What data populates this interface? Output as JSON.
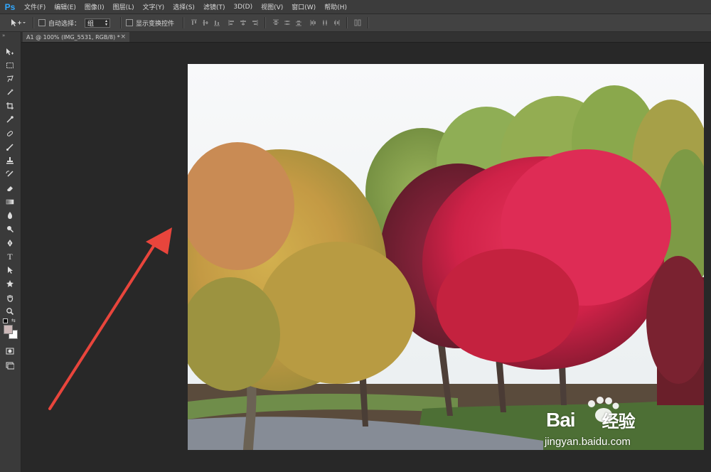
{
  "app": {
    "logo": "Ps"
  },
  "menu": [
    "文件(F)",
    "编辑(E)",
    "图像(I)",
    "图层(L)",
    "文字(Y)",
    "选择(S)",
    "滤镜(T)",
    "3D(D)",
    "视图(V)",
    "窗口(W)",
    "帮助(H)"
  ],
  "options": {
    "auto_select_label": "自动选择：",
    "auto_select_value": "组",
    "show_transform_label": "显示变换控件"
  },
  "document_tab": {
    "title": "A1 @ 100% (IMG_5531, RGB/8) *",
    "close": "×"
  },
  "tools": [
    "move-icon",
    "marquee-icon",
    "lasso-icon",
    "quick-select-icon",
    "crop-icon",
    "eyedropper-icon",
    "healing-brush-icon",
    "brush-icon",
    "stamp-icon",
    "history-brush-icon",
    "eraser-icon",
    "gradient-icon",
    "blur-icon",
    "dodge-icon",
    "pen-icon",
    "type-icon",
    "path-select-icon",
    "shape-icon",
    "hand-icon",
    "zoom-icon",
    "color-swatch-icon",
    "quick-mask-icon",
    "screen-mode-icon"
  ],
  "tool_glyphs": {
    "type": "T"
  },
  "colors": {
    "foreground": "#cbb7b7",
    "background": "#ffffff",
    "arrow": "#e8453c",
    "ps_blue": "#31a8ff"
  },
  "watermark": {
    "brand_left": "Bai",
    "brand_right": "经验",
    "url": "jingyan.baidu.com"
  }
}
